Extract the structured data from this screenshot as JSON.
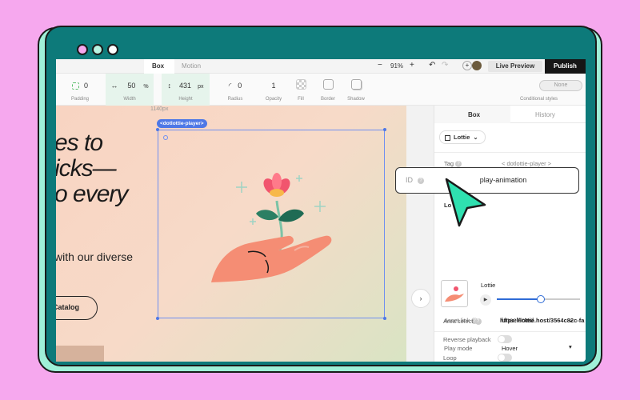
{
  "topbar": {
    "tabs": [
      "Box",
      "Motion"
    ],
    "zoom": "91%",
    "live_preview": "Live Preview",
    "publish": "Publish"
  },
  "toolbar": {
    "padding_value": "0",
    "padding_label": "Padding",
    "width_value": "50",
    "width_unit": "%",
    "width_label": "Width",
    "height_value": "431",
    "height_unit": "px",
    "height_label": "Height",
    "radius_value": "0",
    "radius_label": "Radius",
    "opacity_value": "1",
    "opacity_label": "Opacity",
    "fill_label": "Fill",
    "border_label": "Border",
    "shadow_label": "Shadow",
    "cond_value": "None",
    "cond_label": "Conditional styles"
  },
  "canvas": {
    "width_hint": "1140px",
    "element_tag": "<dotlottie-player>",
    "headline_lines": [
      "es to",
      "icks—",
      "o every"
    ],
    "subtext": "with our diverse",
    "catalog_button": "Catalog"
  },
  "panel": {
    "tabs": [
      "Box",
      "History"
    ],
    "component": "Lottie",
    "tag_label": "Tag",
    "tag_value": "< dotlottie-player >",
    "section_label": "Lo",
    "lottie_label": "Lottie",
    "progress": 0.53,
    "asset_label": "Asset link",
    "asset_value": "https://lottie.host/3564c82c-fa",
    "play_mode_label": "Play mode",
    "play_mode_value": "Hover",
    "area_label": "Area select",
    "area_value": "Unselected",
    "reverse_label": "Reverse playback",
    "loop_label": "Loop"
  },
  "id_popover": {
    "label": "ID",
    "value": "play-animation"
  },
  "colors": {
    "background": "#f6a8ee",
    "frame": "#0d7a7a",
    "cursor": "#2fe0b0",
    "selection": "#4e78e6"
  }
}
